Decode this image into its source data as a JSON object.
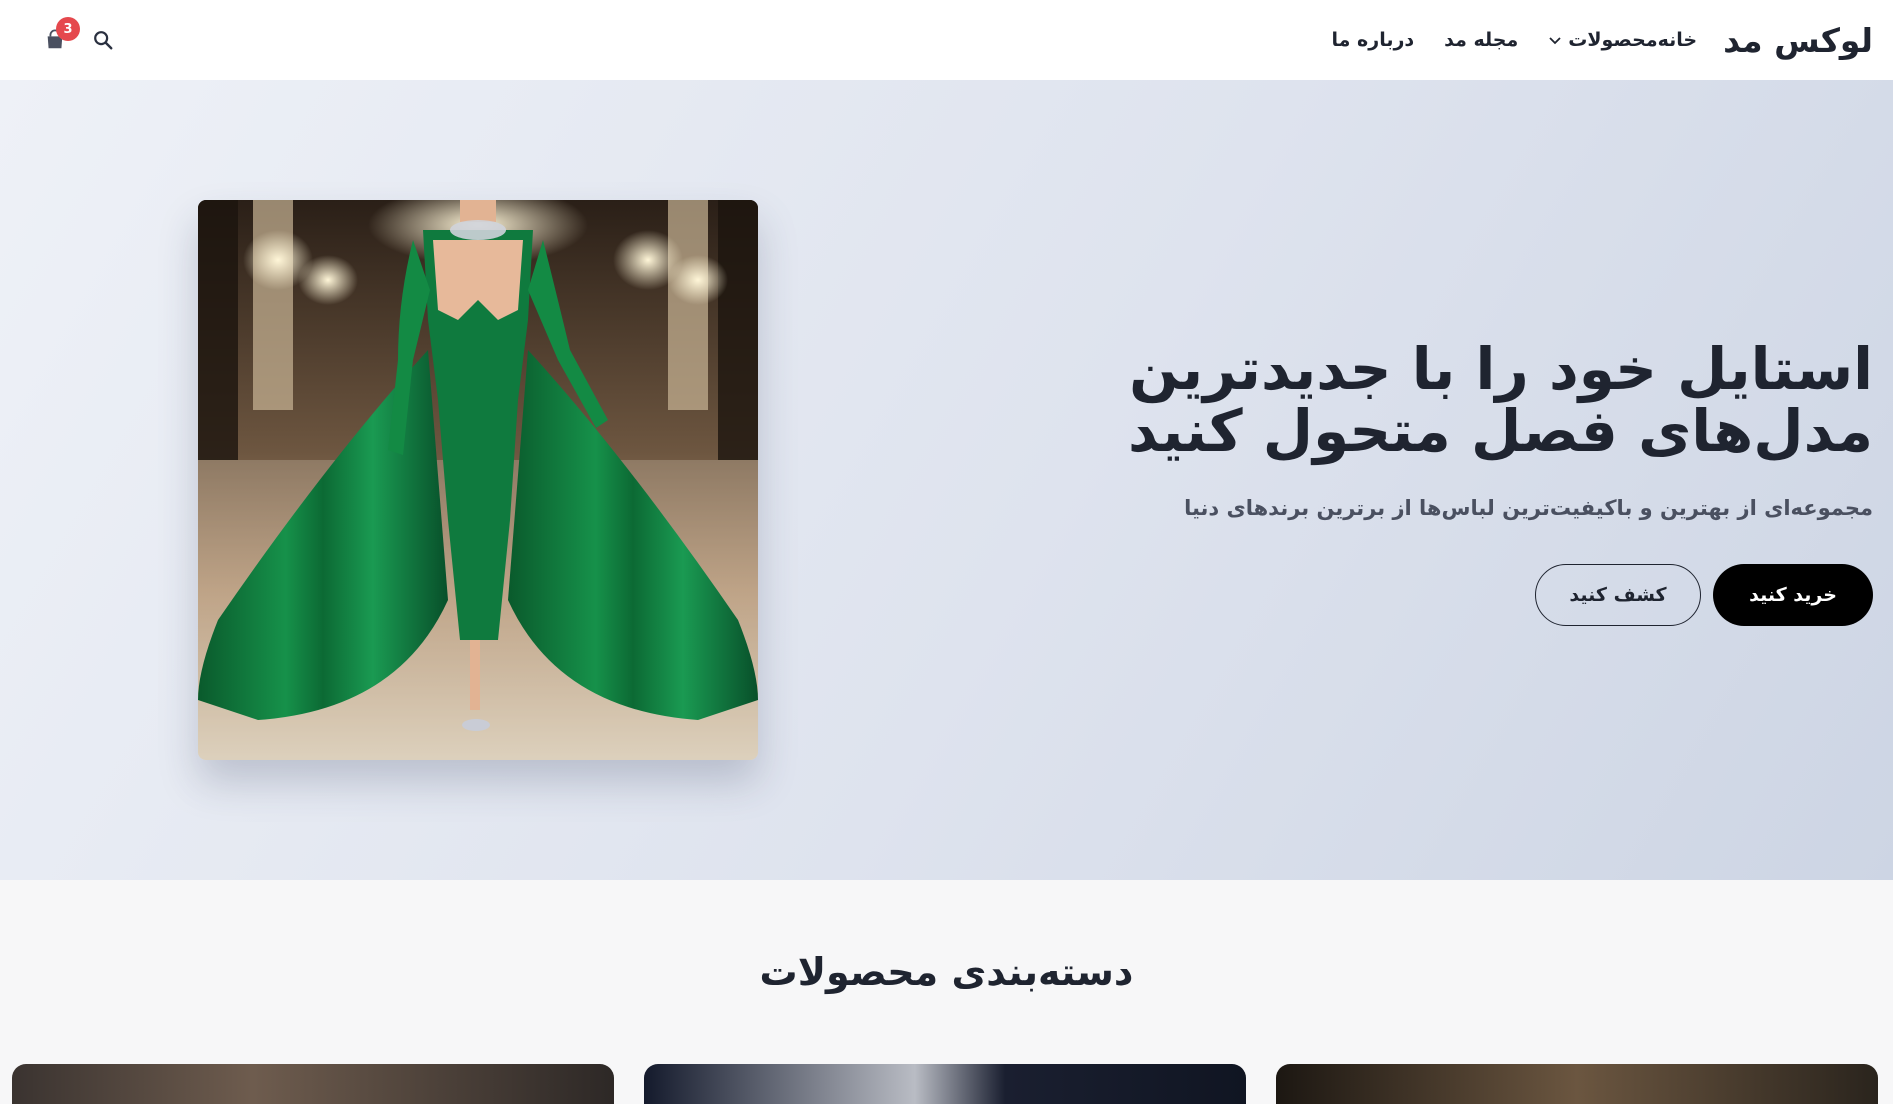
{
  "header": {
    "logo": "لوکس مد",
    "nav": [
      {
        "label": "خانه"
      },
      {
        "label": "محصولات",
        "has_dropdown": true
      },
      {
        "label": "مجله مد"
      },
      {
        "label": "درباره ما"
      }
    ],
    "cart_count": "3",
    "icons": [
      "search-icon",
      "shopping-bag-icon",
      "chevron-down-icon"
    ]
  },
  "hero": {
    "title": "استایل خود را با جدیدترین مدل‌های فصل متحول کنید",
    "subtitle": "مجموعه‌ای از بهترین و باکیفیت‌ترین لباس‌ها از برترین برندهای دنیا",
    "primary_button": "خرید کنید",
    "secondary_button": "کشف کنید"
  },
  "categories": {
    "title": "دسته‌بندی محصولات"
  },
  "colors": {
    "accent": "#000000",
    "badge": "#e5484d",
    "hero_bg": "#dee3ee",
    "dress_green": "#0f7a3e"
  }
}
